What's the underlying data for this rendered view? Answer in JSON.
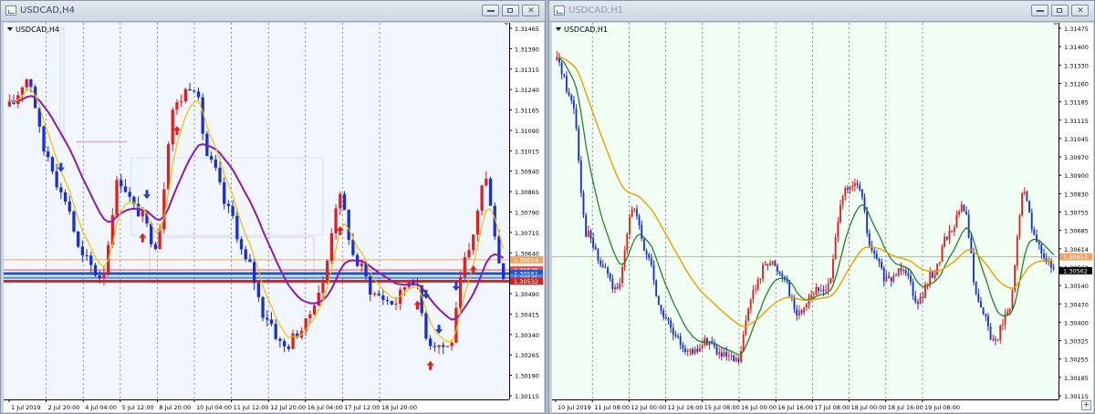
{
  "windows": [
    {
      "title": "USDCAD,H4",
      "chart_symbol": "USDCAD,H4",
      "active": true,
      "chart_data": {
        "type": "candlestick",
        "symbol": "USDCAD",
        "timeframe": "H4",
        "y_ticks": [
          "1.31465",
          "1.31390",
          "1.31315",
          "1.31240",
          "1.31165",
          "1.31090",
          "1.31015",
          "1.30940",
          "1.30865",
          "1.30790",
          "1.30715",
          "1.30640",
          "1.30565",
          "1.30490",
          "1.30415",
          "1.30340",
          "1.30265",
          "1.30190",
          "1.30115"
        ],
        "ylim": [
          1.3008,
          1.3152
        ],
        "x_ticks": [
          "1 Jul 2019",
          "2 Jul 20:00",
          "4 Jul 04:00",
          "5 Jul 12:00",
          "8 Jul 20:00",
          "10 Jul 04:00",
          "11 Jul 12:00",
          "12 Jul 20:00",
          "16 Jul 04:00",
          "17 Jul 12:00",
          "18 Jul 20:00"
        ],
        "price_labels": [
          {
            "value": "1.30614",
            "price": 1.30614,
            "color": "#f4a460"
          },
          {
            "value": "1.30575",
            "price": 1.30575,
            "color": "#e84a4a"
          },
          {
            "value": "1.30561",
            "price": 1.30561,
            "color": "#1e56c8"
          },
          {
            "value": "1.30545",
            "price": 1.30545,
            "color": "#3a86ff"
          },
          {
            "value": "1.30532",
            "price": 1.30532,
            "color": "#d92020"
          }
        ],
        "horizontal_lines": [
          {
            "price": 1.30614,
            "color": "#f4a460",
            "width": 1
          },
          {
            "price": 1.30575,
            "color": "#e84a4a",
            "width": 1
          },
          {
            "price": 1.30561,
            "color": "#1e56c8",
            "width": 3
          },
          {
            "price": 1.30545,
            "color": "#3a86ff",
            "width": 2
          },
          {
            "price": 1.30532,
            "color": "#d92020",
            "width": 3
          }
        ],
        "candle_color_up": "#e02020",
        "candle_color_down": "#1a2fd0",
        "moving_averages": [
          {
            "color": "#8a1bb3",
            "period_label": "slow"
          },
          {
            "color": "#f0c000",
            "period_label": "fast"
          }
        ],
        "arrow_colors": {
          "buy": "#e02020",
          "sell": "#1a3fd0"
        },
        "arrows": [
          {
            "type": "sell",
            "bar": 12
          },
          {
            "type": "sell",
            "bar": 32
          },
          {
            "type": "buy",
            "bar": 31
          },
          {
            "type": "buy",
            "bar": 39
          },
          {
            "type": "sell",
            "bar": 97
          },
          {
            "type": "sell",
            "bar": 100
          },
          {
            "type": "buy",
            "bar": 77
          },
          {
            "type": "buy",
            "bar": 95
          },
          {
            "type": "buy",
            "bar": 98
          },
          {
            "type": "sell",
            "bar": 104
          },
          {
            "type": "buy",
            "bar": 108
          }
        ]
      }
    },
    {
      "title": "USDCAD,H1",
      "chart_symbol": "USDCAD,H1",
      "active": false,
      "chart_data": {
        "type": "candlestick",
        "symbol": "USDCAD",
        "timeframe": "H1",
        "y_ticks": [
          "1.31475",
          "1.31400",
          "1.31330",
          "1.31260",
          "1.31185",
          "1.31115",
          "1.31045",
          "1.30970",
          "1.30900",
          "1.30830",
          "1.30755",
          "1.30685",
          "1.30614",
          "1.30562",
          "1.30540",
          "1.30470",
          "1.30400",
          "1.30325",
          "1.30255",
          "1.30185",
          "1.30115"
        ],
        "ylim": [
          1.3008,
          1.3149
        ],
        "x_ticks": [
          "10 Jul 2019",
          "11 Jul 08:00",
          "12 Jul 00:00",
          "12 Jul 16:00",
          "15 Jul 08:00",
          "16 Jul 00:00",
          "16 Jul 16:00",
          "17 Jul 08:00",
          "18 Jul 00:00",
          "18 Jul 16:00",
          "19 Jul 08:00"
        ],
        "price_labels": [
          {
            "value": "1.30614",
            "price": 1.30614,
            "color": "#f4a460"
          },
          {
            "value": "1.30562",
            "price": 1.30562,
            "color": "#000000"
          }
        ],
        "horizontal_lines": [
          {
            "price": 1.30614,
            "color": "#f4a460",
            "width": 1
          }
        ],
        "candle_color_up": "#e02020",
        "candle_color_down": "#1a2fd0",
        "moving_averages": [
          {
            "color": "#1a7a1a",
            "period_label": "fast"
          },
          {
            "color": "#e8a000",
            "period_label": "slow"
          }
        ]
      }
    }
  ]
}
